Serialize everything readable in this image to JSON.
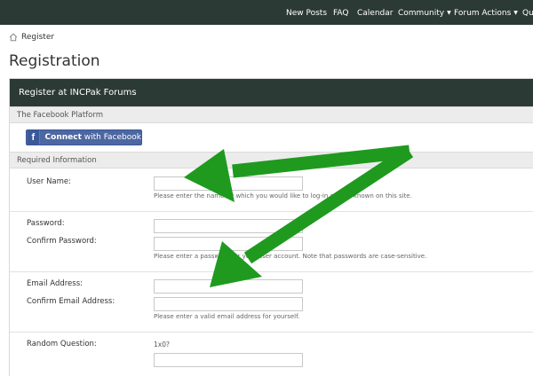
{
  "nav": {
    "items": [
      {
        "label": "New Posts",
        "dropdown": false
      },
      {
        "label": "FAQ",
        "dropdown": false
      },
      {
        "label": "Calendar",
        "dropdown": false
      },
      {
        "label": "Community",
        "dropdown": true
      },
      {
        "label": "Forum Actions",
        "dropdown": true
      },
      {
        "label": "Qu",
        "dropdown": false
      }
    ]
  },
  "breadcrumb": {
    "label": "Register",
    "icon": "home-icon"
  },
  "page_title": "Registration",
  "form": {
    "header": "Register at INCPak Forums",
    "facebook_section": "The Facebook Platform",
    "facebook_button": {
      "brand": "Connect",
      "rest": " with Facebook",
      "color": "#3b5998"
    },
    "required_section": "Required Information",
    "username": {
      "label": "User Name:",
      "value": "",
      "hint": "Please enter the name by which you would like to log-in and be known on this site."
    },
    "password": {
      "label": "Password:",
      "value": ""
    },
    "confirm_password": {
      "label": "Confirm Password:",
      "value": "",
      "hint": "Please enter a password for your user account. Note that passwords are case-sensitive."
    },
    "email": {
      "label": "Email Address:",
      "value": ""
    },
    "confirm_email": {
      "label": "Confirm Email Address:",
      "value": "",
      "hint": "Please enter a valid email address for yourself."
    },
    "random_question": {
      "label": "Random Question:",
      "question": "1x0?",
      "value": ""
    }
  },
  "colors": {
    "nav_bg": "#2c3a35",
    "arrow_green": "#1f9a1f",
    "facebook_blue": "#3b5998"
  }
}
